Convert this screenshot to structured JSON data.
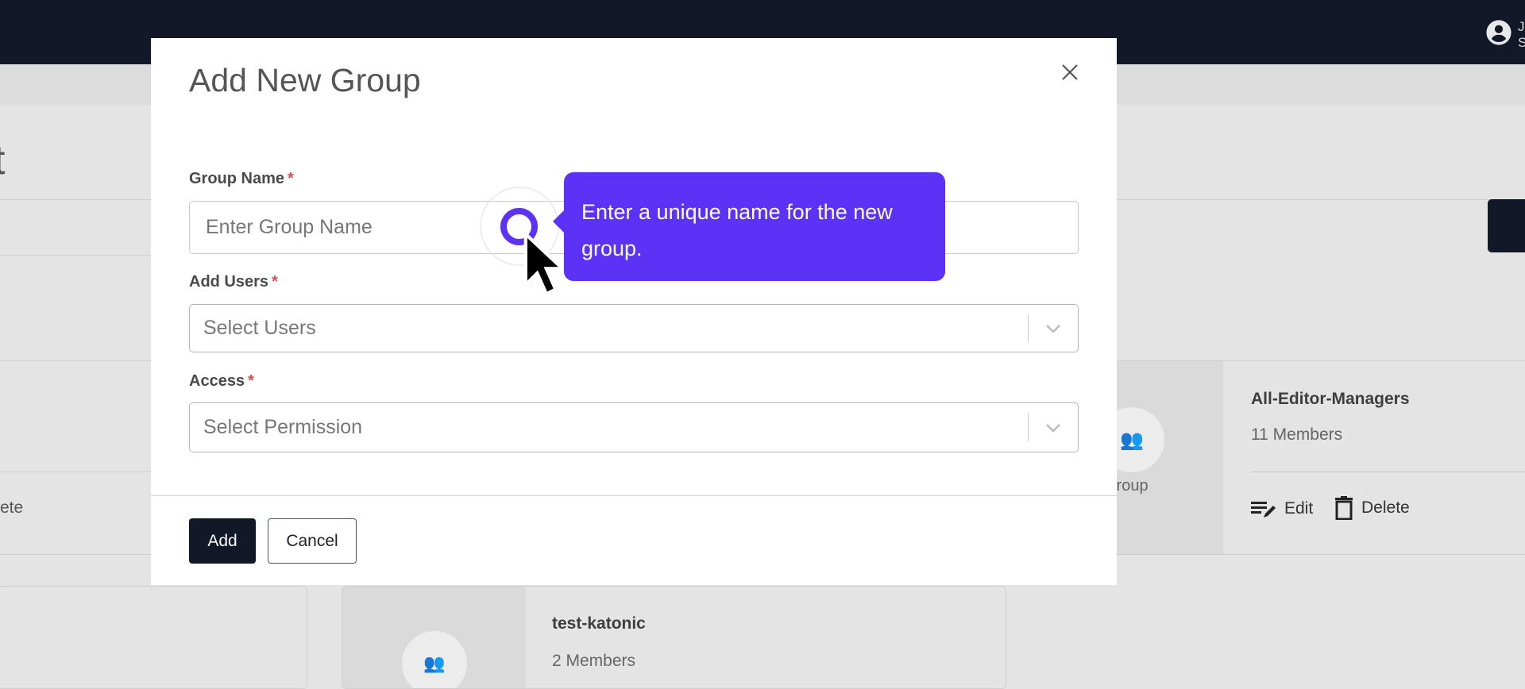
{
  "header": {
    "user_initial_line1": "J",
    "user_initial_line2": "S"
  },
  "background": {
    "page_title_fragment": "t",
    "left_delete_fragment": "ete",
    "cards": [
      {
        "name": "All-Editor-Managers",
        "members": "11 Members",
        "icon_caption": "Group",
        "edit_label": "Edit",
        "delete_label": "Delete"
      },
      {
        "name": "test-katonic",
        "members": "2 Members"
      }
    ]
  },
  "modal": {
    "title": "Add New Group",
    "group_name_label": "Group Name",
    "group_name_placeholder": "Enter Group Name",
    "add_users_label": "Add Users",
    "add_users_placeholder": "Select Users",
    "access_label": "Access",
    "access_placeholder": "Select Permission",
    "required_mark": "*",
    "add_button": "Add",
    "cancel_button": "Cancel"
  },
  "tooltip": {
    "text": "Enter a unique name for the new group.",
    "color": "#5b32f6"
  }
}
